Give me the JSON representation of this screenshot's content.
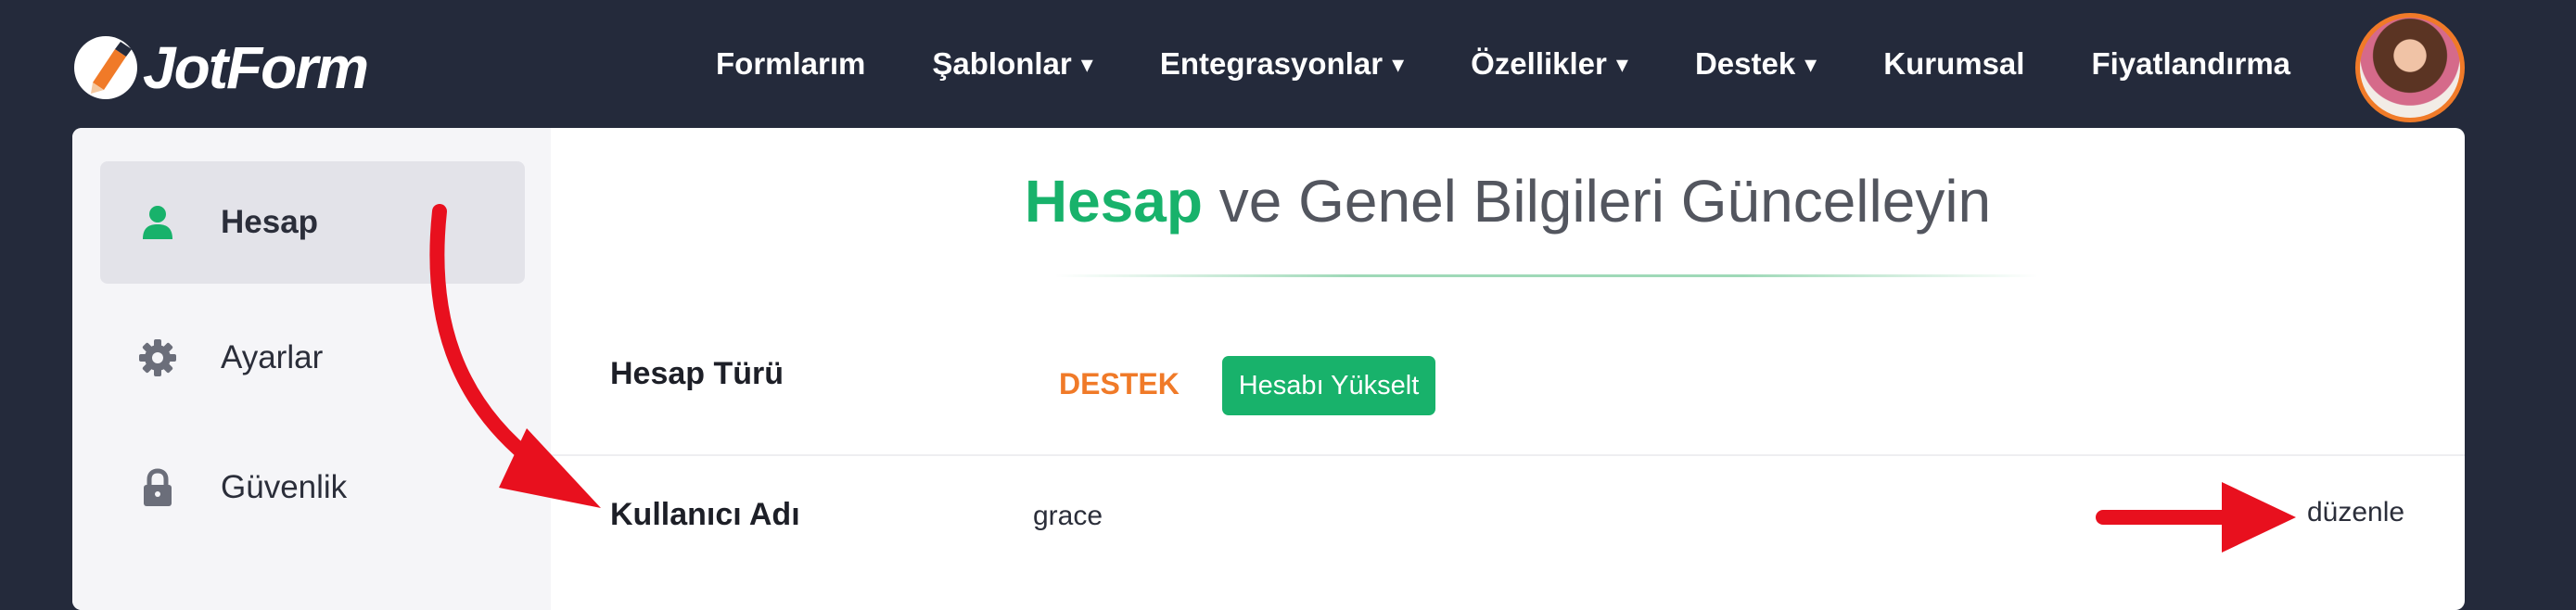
{
  "brand": {
    "name": "JotForm"
  },
  "nav": {
    "items": [
      {
        "label": "Formlarım",
        "has_caret": false
      },
      {
        "label": "Şablonlar",
        "has_caret": true
      },
      {
        "label": "Entegrasyonlar",
        "has_caret": true
      },
      {
        "label": "Özellikler",
        "has_caret": true
      },
      {
        "label": "Destek",
        "has_caret": true
      },
      {
        "label": "Kurumsal",
        "has_caret": false
      },
      {
        "label": "Fiyatlandırma",
        "has_caret": false
      }
    ],
    "caret": "▾"
  },
  "sidebar": {
    "items": [
      {
        "label": "Hesap",
        "icon": "user-icon",
        "active": true
      },
      {
        "label": "Ayarlar",
        "icon": "gear-icon",
        "active": false
      },
      {
        "label": "Güvenlik",
        "icon": "lock-icon",
        "active": false
      }
    ]
  },
  "main": {
    "heading_accent": "Hesap",
    "heading_rest": " ve Genel Bilgileri Güncelleyin",
    "account_type": {
      "label": "Hesap Türü",
      "badge": "DESTEK",
      "upgrade_button": "Hesabı Yükselt"
    },
    "username": {
      "label": "Kullanıcı Adı",
      "value": "grace",
      "edit_link": "düzenle"
    }
  },
  "colors": {
    "topbar_bg": "#242a3b",
    "accent_green": "#18b26b",
    "badge_orange": "#f07a28",
    "annotation_red": "#e8101e"
  }
}
